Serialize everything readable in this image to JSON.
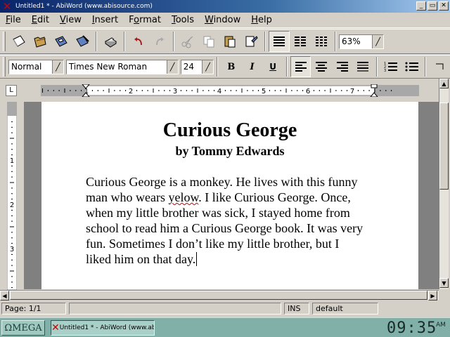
{
  "window": {
    "title": "Untitled1 * - AbiWord (www.abisource.com)",
    "controls": [
      "_",
      "▭",
      "✕"
    ]
  },
  "menu": [
    {
      "label": "File",
      "mnemonic": "F",
      "rest": "ile"
    },
    {
      "label": "Edit",
      "mnemonic": "E",
      "rest": "dit"
    },
    {
      "label": "View",
      "mnemonic": "V",
      "rest": "iew"
    },
    {
      "label": "Insert",
      "mnemonic": "I",
      "rest": "nsert"
    },
    {
      "label": "Format",
      "mnemonic": "o",
      "pre": "F",
      "rest": "rmat"
    },
    {
      "label": "Tools",
      "mnemonic": "T",
      "rest": "ools"
    },
    {
      "label": "Window",
      "mnemonic": "W",
      "rest": "indow"
    },
    {
      "label": "Help",
      "mnemonic": "H",
      "rest": "elp"
    }
  ],
  "toolbar": {
    "zoom": "63%",
    "style": "Normal",
    "font": "Times New Roman",
    "size": "24",
    "bold": "B",
    "italic": "I",
    "underline": "U"
  },
  "ruler": {
    "h_labels": [
      "1",
      "2",
      "3",
      "4",
      "5",
      "6",
      "7"
    ],
    "v_labels": [
      "1",
      "2",
      "3"
    ],
    "corner": "L"
  },
  "document": {
    "title": "Curious George",
    "subtitle": "by Tommy Edwards",
    "body_before": "Curious George is a monkey. He lives with this funny man who wears ",
    "misspelled_word": "yelow",
    "body_after": ". I like Curious George. Once, when my little brother was sick, I stayed home from school to read him a Curious George book. It was very fun. Sometimes I don’t like my little brother, but I liked him on that day."
  },
  "statusbar": {
    "page": "Page: 1/1",
    "mode": "INS",
    "lang": "default"
  },
  "taskbar": {
    "start_label": "ΩMEGA",
    "task_label": "Untitled1 * - AbiWord (www.ab...",
    "time": "09:35",
    "ampm": "AM"
  },
  "colors": {
    "titlebar_start": "#0a246a",
    "taskbar": "#80b0a8",
    "spelling_underline": "#d00000"
  }
}
